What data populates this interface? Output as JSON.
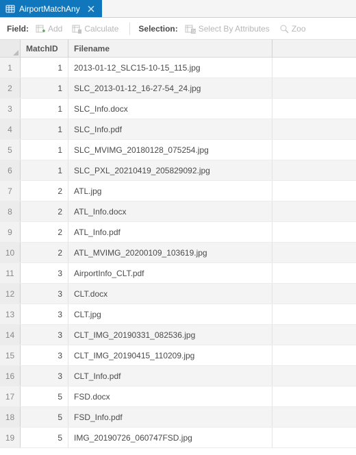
{
  "tab": {
    "title": "AirportMatchAny"
  },
  "toolbar": {
    "field_label": "Field:",
    "add_label": "Add",
    "calculate_label": "Calculate",
    "selection_label": "Selection:",
    "select_by_attributes_label": "Select By Attributes",
    "zoom_label": "Zoo"
  },
  "columns": {
    "matchid": "MatchID",
    "filename": "Filename"
  },
  "rows": [
    {
      "n": "1",
      "matchid": "1",
      "filename": "2013-01-12_SLC15-10-15_115.jpg"
    },
    {
      "n": "2",
      "matchid": "1",
      "filename": "SLC_2013-01-12_16-27-54_24.jpg"
    },
    {
      "n": "3",
      "matchid": "1",
      "filename": "SLC_Info.docx"
    },
    {
      "n": "4",
      "matchid": "1",
      "filename": "SLC_Info.pdf"
    },
    {
      "n": "5",
      "matchid": "1",
      "filename": "SLC_MVIMG_20180128_075254.jpg"
    },
    {
      "n": "6",
      "matchid": "1",
      "filename": "SLC_PXL_20210419_205829092.jpg"
    },
    {
      "n": "7",
      "matchid": "2",
      "filename": "ATL.jpg"
    },
    {
      "n": "8",
      "matchid": "2",
      "filename": "ATL_Info.docx"
    },
    {
      "n": "9",
      "matchid": "2",
      "filename": "ATL_Info.pdf"
    },
    {
      "n": "10",
      "matchid": "2",
      "filename": "ATL_MVIMG_20200109_103619.jpg"
    },
    {
      "n": "11",
      "matchid": "3",
      "filename": "AirportInfo_CLT.pdf"
    },
    {
      "n": "12",
      "matchid": "3",
      "filename": "CLT.docx"
    },
    {
      "n": "13",
      "matchid": "3",
      "filename": "CLT.jpg"
    },
    {
      "n": "14",
      "matchid": "3",
      "filename": "CLT_IMG_20190331_082536.jpg"
    },
    {
      "n": "15",
      "matchid": "3",
      "filename": "CLT_IMG_20190415_110209.jpg"
    },
    {
      "n": "16",
      "matchid": "3",
      "filename": "CLT_Info.pdf"
    },
    {
      "n": "17",
      "matchid": "5",
      "filename": "FSD.docx"
    },
    {
      "n": "18",
      "matchid": "5",
      "filename": "FSD_Info.pdf"
    },
    {
      "n": "19",
      "matchid": "5",
      "filename": "IMG_20190726_060747FSD.jpg"
    }
  ]
}
